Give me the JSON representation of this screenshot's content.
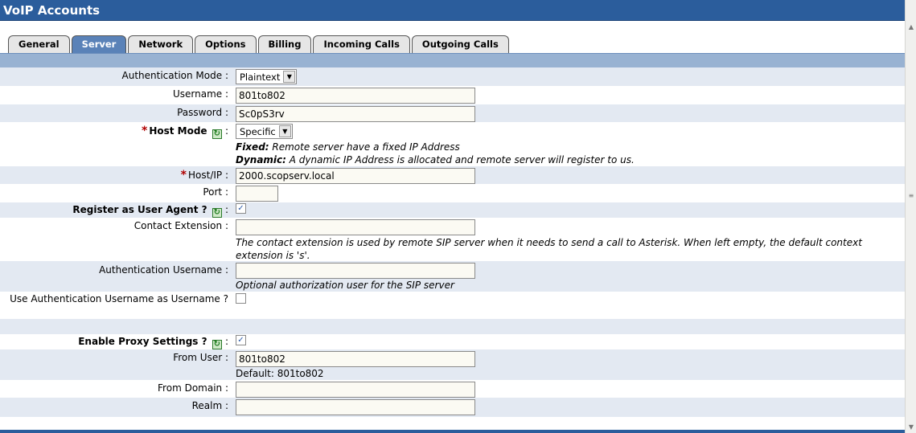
{
  "header": {
    "title": "VoIP Accounts"
  },
  "tabs": [
    {
      "label": "General"
    },
    {
      "label": "Server",
      "active": true
    },
    {
      "label": "Network"
    },
    {
      "label": "Options"
    },
    {
      "label": "Billing"
    },
    {
      "label": "Incoming Calls"
    },
    {
      "label": "Outgoing Calls"
    }
  ],
  "form": {
    "auth_mode": {
      "label": "Authentication Mode",
      "value": "Plaintext"
    },
    "username": {
      "label": "Username",
      "value": "801to802"
    },
    "password": {
      "label": "Password",
      "value": "Sc0pS3rv"
    },
    "host_mode": {
      "label": "Host Mode",
      "value": "Specific",
      "fixed_term": "Fixed:",
      "fixed_text": " Remote server have a fixed IP Address",
      "dynamic_term": "Dynamic:",
      "dynamic_text": " A dynamic IP Address is allocated and remote server will register to us."
    },
    "host_ip": {
      "label": "Host/IP",
      "value": "2000.scopserv.local"
    },
    "port": {
      "label": "Port",
      "value": ""
    },
    "register_agent": {
      "label": "Register as User Agent ?",
      "checked": true
    },
    "contact_ext": {
      "label": "Contact Extension",
      "value": "",
      "help": "The contact extension is used by remote SIP server when it needs to send a call to Asterisk. When left empty, the default context extension is 's'."
    },
    "auth_username": {
      "label": "Authentication Username",
      "value": "",
      "help": "Optional authorization user for the SIP server"
    },
    "use_auth_as_user": {
      "label": "Use Authentication Username as Username ?",
      "checked": false
    },
    "enable_proxy": {
      "label": "Enable Proxy Settings ?",
      "checked": true
    },
    "from_user": {
      "label": "From User",
      "value": "801to802",
      "default_text": "Default: 801to802"
    },
    "from_domain": {
      "label": "From Domain",
      "value": ""
    },
    "realm": {
      "label": "Realm",
      "value": ""
    }
  },
  "colors": {
    "header": "#2b5d9c",
    "active_tab": "#5a82b8",
    "row_alt": "#e3e9f2",
    "required": "#b00000"
  },
  "icons": {
    "help": "refresh-help-icon",
    "required": "asterisk-icon",
    "dropdown": "chevron-down-icon"
  }
}
